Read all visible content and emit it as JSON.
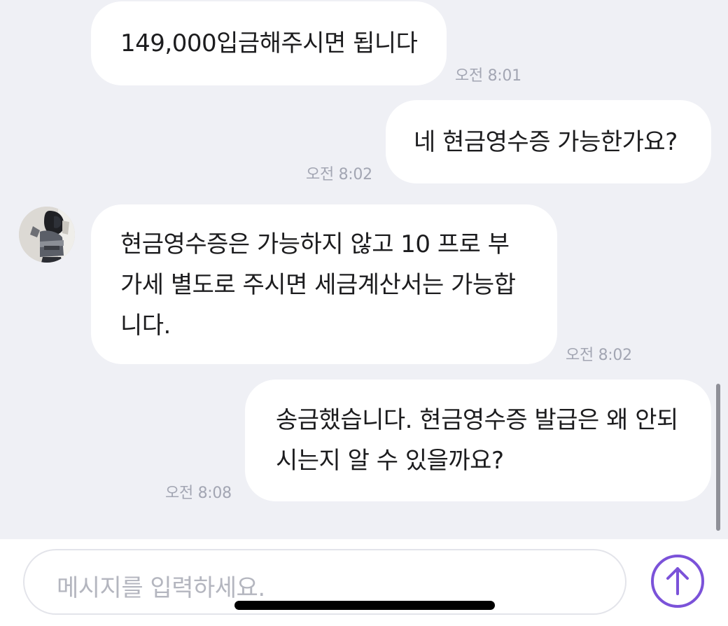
{
  "messages": [
    {
      "sender": "other",
      "text": "149,000입금해주시면 됩니다",
      "time": "오전 8:01"
    },
    {
      "sender": "me",
      "text": "네 현금영수증 가능한가요?",
      "time": "오전 8:02"
    },
    {
      "sender": "other",
      "lines": [
        "현금영수증은 가능하지 않고 10 프로 부",
        "가세 별도로 주시면 세금계산서는 가능합",
        "니다."
      ],
      "time": "오전 8:02"
    },
    {
      "sender": "me",
      "lines": [
        "송금했습니다. 현금영수증 발급은 왜 안되",
        "시는지 알 수 있을까요?"
      ],
      "time": "오전 8:08"
    }
  ],
  "input": {
    "placeholder": "메시지를 입력하세요."
  },
  "icons": {
    "send": "arrow-up-circle-icon",
    "avatar": "user-avatar"
  },
  "colors": {
    "background": "#eff0f5",
    "bubble": "#ffffff",
    "accent": "#7b52d9",
    "time": "#a3a6b3"
  }
}
